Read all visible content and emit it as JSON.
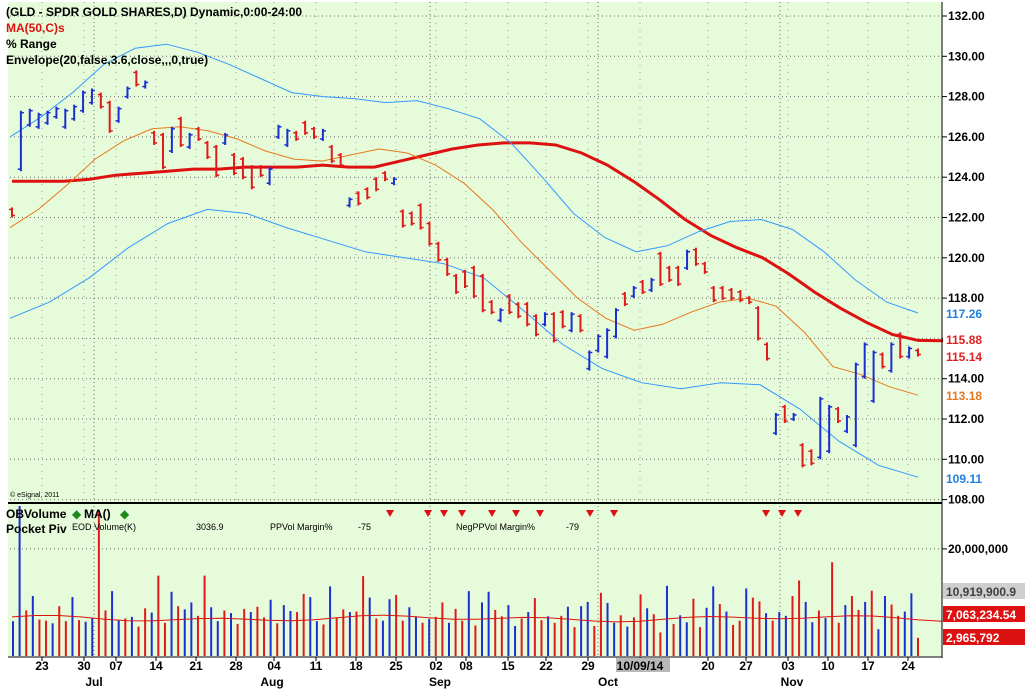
{
  "header": {
    "title": "(GLD - SPDR GOLD SHARES,D) Dynamic,0:00-24:00",
    "ma_label": "MA(50,C)s",
    "range_label": "% Range",
    "envelope_label": "Envelope(20,false,3.6,close,,,0,true)",
    "copyright": "© eSignal, 2011"
  },
  "lower": {
    "title": "OBVolume",
    "ma_label": "MA()",
    "pocket_label": "Pocket Piv",
    "eod_label": "EOD Volume(K)",
    "eod_value": "3036.9",
    "ppvol_label": "PPVol Margin%",
    "ppvol_value": "-75",
    "negppvol_label": "NegPPVol Margin%",
    "negppvol_value": "-79"
  },
  "chart_data": [
    {
      "type": "candlestick",
      "title": "(GLD - SPDR GOLD SHARES,D) Dynamic,0:00-24:00",
      "ylim": [
        107.5,
        133.5
      ],
      "grid": true,
      "y_ticks": [
        "132.00",
        "130.00",
        "128.00",
        "126.00",
        "124.00",
        "122.00",
        "120.00",
        "118.00",
        "116.00",
        "114.00",
        "112.00",
        "110.00",
        "108.00"
      ],
      "x_ticks": [
        "23",
        "30",
        "07",
        "14",
        "21",
        "28",
        "04",
        "11",
        "18",
        "25",
        "02",
        "08",
        "15",
        "22",
        "29",
        "10/09/14",
        "20",
        "27",
        "03",
        "10",
        "17",
        "24"
      ],
      "x_months": [
        "Jul",
        "Aug",
        "Sep",
        "Oct",
        "Nov"
      ],
      "price_labels": [
        {
          "text": "117.26",
          "color": "#1e7fe0"
        },
        {
          "text": "115.88",
          "color": "#dd2222"
        },
        {
          "text": "115.14",
          "color": "#dd2222"
        },
        {
          "text": "113.18",
          "color": "#e8781e"
        },
        {
          "text": "109.11",
          "color": "#1e7fe0"
        }
      ],
      "series": [
        {
          "name": "MA(50,C)s",
          "color": "#dd1111",
          "values": [
            123.8,
            123.8,
            123.8,
            123.9,
            124.1,
            124.2,
            124.3,
            124.4,
            124.4,
            124.5,
            124.5,
            124.5,
            124.6,
            124.5,
            124.5,
            124.8,
            125.1,
            125.4,
            125.6,
            125.7,
            125.7,
            125.6,
            125.2,
            124.6,
            123.8,
            122.9,
            121.9,
            121.1,
            120.5,
            120.0,
            119.2,
            118.3,
            117.5,
            116.8,
            116.2,
            115.9,
            115.88
          ]
        },
        {
          "name": "Envelope mid",
          "color": "#e8781e",
          "values": [
            121.5,
            122.4,
            123.6,
            124.9,
            125.8,
            126.4,
            126.5,
            126.3,
            125.9,
            125.3,
            124.9,
            124.8,
            125.1,
            125.4,
            125.2,
            124.6,
            123.7,
            122.4,
            120.8,
            119.4,
            118.0,
            117.0,
            116.4,
            116.7,
            117.3,
            117.8,
            118.0,
            117.6,
            116.3,
            114.6,
            114.2,
            113.6,
            113.18
          ]
        },
        {
          "name": "Envelope upper",
          "color": "#3399ff",
          "values": [
            126.0,
            127.0,
            128.2,
            129.6,
            130.4,
            130.6,
            130.2,
            129.6,
            128.9,
            128.2,
            128.0,
            127.9,
            127.7,
            127.8,
            127.4,
            126.9,
            125.7,
            124.0,
            122.2,
            121.0,
            120.3,
            120.6,
            121.3,
            121.8,
            121.9,
            121.4,
            120.3,
            118.9,
            117.8,
            117.26
          ]
        },
        {
          "name": "Envelope lower",
          "color": "#3399ff",
          "values": [
            117.0,
            117.8,
            119.0,
            120.5,
            121.7,
            122.4,
            122.2,
            121.5,
            120.9,
            120.3,
            120.0,
            119.7,
            119.0,
            117.4,
            115.7,
            114.5,
            113.8,
            113.5,
            113.8,
            113.7,
            112.5,
            110.9,
            109.7,
            109.11
          ]
        }
      ],
      "bars_up_color": "#1a2fd0",
      "bars_down_color": "#e01a1a",
      "ohlc": [
        [
          122.5,
          122.0,
          "d"
        ],
        [
          127.3,
          124.3,
          "u"
        ],
        [
          127.4,
          126.5,
          "u"
        ],
        [
          127.2,
          126.4,
          "u"
        ],
        [
          127.3,
          126.6,
          "u"
        ],
        [
          127.5,
          126.9,
          "u"
        ],
        [
          127.4,
          126.4,
          "u"
        ],
        [
          127.6,
          126.8,
          "u"
        ],
        [
          128.3,
          127.2,
          "u"
        ],
        [
          128.4,
          127.6,
          "u"
        ],
        [
          128.2,
          127.4,
          "d"
        ],
        [
          127.8,
          126.2,
          "d"
        ],
        [
          127.5,
          126.7,
          "u"
        ],
        [
          128.5,
          127.9,
          "u"
        ],
        [
          129.3,
          128.5,
          "d"
        ],
        [
          128.8,
          128.4,
          "u"
        ],
        [
          126.3,
          125.6,
          "d"
        ],
        [
          126.2,
          124.4,
          "d"
        ],
        [
          126.5,
          125.2,
          "u"
        ],
        [
          127.0,
          125.5,
          "d"
        ],
        [
          126.2,
          125.4,
          "u"
        ],
        [
          126.5,
          125.8,
          "d"
        ],
        [
          125.8,
          124.9,
          "d"
        ],
        [
          125.6,
          124.0,
          "d"
        ],
        [
          126.2,
          125.6,
          "u"
        ],
        [
          125.2,
          124.1,
          "d"
        ],
        [
          125.0,
          123.9,
          "d"
        ],
        [
          124.6,
          123.4,
          "d"
        ],
        [
          124.6,
          124.0,
          "d"
        ],
        [
          124.5,
          123.6,
          "u"
        ],
        [
          126.6,
          125.9,
          "u"
        ],
        [
          126.4,
          125.5,
          "u"
        ],
        [
          126.3,
          125.8,
          "d"
        ],
        [
          126.8,
          126.1,
          "d"
        ],
        [
          126.5,
          125.9,
          "d"
        ],
        [
          126.4,
          125.8,
          "u"
        ],
        [
          125.6,
          124.7,
          "d"
        ],
        [
          125.2,
          124.5,
          "d"
        ],
        [
          123.0,
          122.5,
          "u"
        ],
        [
          123.3,
          122.6,
          "d"
        ],
        [
          123.5,
          122.9,
          "d"
        ],
        [
          124.0,
          123.3,
          "d"
        ],
        [
          124.3,
          123.8,
          "d"
        ],
        [
          124.0,
          123.6,
          "u"
        ],
        [
          122.4,
          121.5,
          "d"
        ],
        [
          122.3,
          121.6,
          "d"
        ],
        [
          122.7,
          121.4,
          "d"
        ],
        [
          121.8,
          120.6,
          "d"
        ],
        [
          120.8,
          119.8,
          "d"
        ],
        [
          120.0,
          119.1,
          "d"
        ],
        [
          119.2,
          118.2,
          "d"
        ],
        [
          119.4,
          118.5,
          "d"
        ],
        [
          119.6,
          118.0,
          "d"
        ],
        [
          119.2,
          117.3,
          "d"
        ],
        [
          117.9,
          117.2,
          "d"
        ],
        [
          117.5,
          116.8,
          "u"
        ],
        [
          118.2,
          117.2,
          "d"
        ],
        [
          117.8,
          117.0,
          "d"
        ],
        [
          117.8,
          116.6,
          "d"
        ],
        [
          117.2,
          116.1,
          "d"
        ],
        [
          117.3,
          116.6,
          "u"
        ],
        [
          117.3,
          115.8,
          "d"
        ],
        [
          117.4,
          116.5,
          "d"
        ],
        [
          117.3,
          116.3,
          "u"
        ],
        [
          117.2,
          116.3,
          "d"
        ],
        [
          115.4,
          114.4,
          "u"
        ],
        [
          116.2,
          115.3,
          "u"
        ],
        [
          116.5,
          115.0,
          "u"
        ],
        [
          117.5,
          116.0,
          "u"
        ],
        [
          118.3,
          117.6,
          "d"
        ],
        [
          118.6,
          118.0,
          "u"
        ],
        [
          118.9,
          118.2,
          "d"
        ],
        [
          119.0,
          118.3,
          "u"
        ],
        [
          120.3,
          118.6,
          "d"
        ],
        [
          119.6,
          118.8,
          "d"
        ],
        [
          119.6,
          118.6,
          "d"
        ],
        [
          120.4,
          119.4,
          "u"
        ],
        [
          120.5,
          119.6,
          "d"
        ],
        [
          119.8,
          119.2,
          "d"
        ],
        [
          118.6,
          117.8,
          "d"
        ],
        [
          118.6,
          117.9,
          "d"
        ],
        [
          118.5,
          117.9,
          "d"
        ],
        [
          118.4,
          117.8,
          "d"
        ],
        [
          118.1,
          117.7,
          "d"
        ],
        [
          117.6,
          115.9,
          "d"
        ],
        [
          115.8,
          114.9,
          "d"
        ],
        [
          112.3,
          111.2,
          "u"
        ],
        [
          112.7,
          111.8,
          "d"
        ],
        [
          112.3,
          111.9,
          "u"
        ],
        [
          110.8,
          109.6,
          "d"
        ],
        [
          110.5,
          109.7,
          "d"
        ],
        [
          113.1,
          110.0,
          "u"
        ],
        [
          112.7,
          110.3,
          "u"
        ],
        [
          112.6,
          111.8,
          "d"
        ],
        [
          112.2,
          111.3,
          "u"
        ],
        [
          114.8,
          110.6,
          "u"
        ],
        [
          115.8,
          114.0,
          "u"
        ],
        [
          115.4,
          112.8,
          "u"
        ],
        [
          115.3,
          114.5,
          "d"
        ],
        [
          115.8,
          114.3,
          "u"
        ],
        [
          116.3,
          115.0,
          "d"
        ],
        [
          115.6,
          115.0,
          "u"
        ],
        [
          115.5,
          115.1,
          "d"
        ]
      ]
    },
    {
      "type": "bar",
      "title": "OBVolume",
      "ylim": [
        0,
        28000000
      ],
      "y_ticks": [
        "20,000,000"
      ],
      "volume_labels": [
        {
          "text": "10,919,900.9",
          "color": "#404040",
          "bg": "#cfcfcf"
        },
        {
          "text": "7,063,234.54",
          "color": "#ffffff",
          "bg": "#dd1111"
        },
        {
          "text": "2,965,792",
          "color": "#ffffff",
          "bg": "#dd1111"
        }
      ],
      "ma_line_value": 7000000,
      "markers_down": 11,
      "values_millions": [
        6.5,
        30.0,
        8.5,
        11.2,
        6.8,
        6.6,
        6.1,
        9.3,
        6.5,
        11.0,
        6.7,
        6.4,
        7.1,
        27.1,
        8.5,
        12.1,
        6.7,
        7.0,
        7.3,
        5.5,
        8.9,
        8.1,
        15.0,
        6.2,
        12.0,
        9.3,
        8.7,
        10.0,
        7.5,
        15.0,
        9.1,
        6.5,
        8.5,
        8.0,
        6.0,
        8.8,
        8.2,
        9.2,
        7.2,
        10.5,
        6.1,
        9.5,
        8.4,
        8.2,
        11.6,
        11.0,
        6.5,
        5.9,
        13.0,
        7.2,
        8.7,
        8.2,
        8.3,
        14.9,
        10.9,
        7.0,
        6.6,
        10.6,
        11.4,
        6.6,
        9.1,
        7.4,
        6.2,
        6.9,
        7.3,
        10.0,
        6.2,
        8.8,
        6.6,
        12.1,
        5.7,
        10.0,
        12.0,
        8.6,
        7.4,
        9.5,
        5.6,
        7.0,
        8.2,
        10.8,
        6.7,
        7.4,
        6.2,
        7.5,
        9.2,
        5.4,
        9.3,
        10.1,
        5.6,
        11.8,
        9.9,
        6.2,
        7.6,
        5.5,
        7.2,
        11.5,
        8.9,
        7.8,
        4.4,
        13.1,
        6.0,
        7.6,
        6.3,
        10.7,
        5.4,
        9.0,
        13.0,
        9.7,
        8.3,
        5.8,
        6.6,
        12.6,
        10.9,
        10.2,
        8.0,
        6.6,
        8.2,
        7.5,
        11.2,
        14.1,
        10.1,
        6.3,
        8.5,
        7.1,
        17.5,
        6.2,
        9.5,
        11.2,
        8.6,
        10.1,
        12.2,
        5.0,
        11.2,
        9.6,
        7.5,
        8.3,
        11.7,
        3.4
      ],
      "colors_pattern": "alternating"
    }
  ]
}
